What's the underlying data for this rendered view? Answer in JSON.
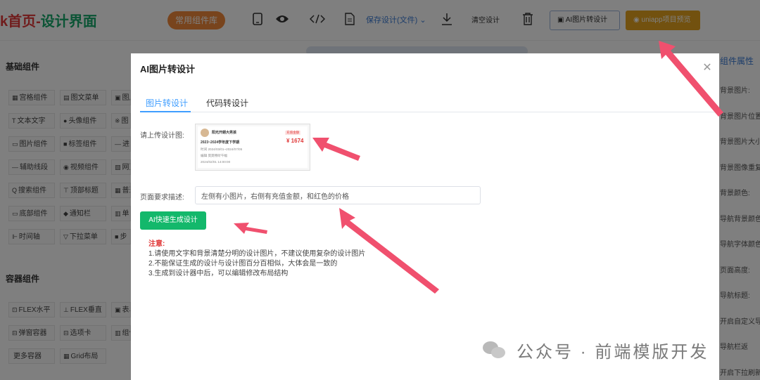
{
  "topbar": {
    "brand_part1": "k首页-",
    "brand_part2": "设计界面",
    "component_lib_label": "常用组件库",
    "save_label": "保存设计(文件)",
    "clear_label": "清空设计",
    "ai_image_label": "AI图片转设计",
    "preview_label": "uniapp项目预览"
  },
  "left": {
    "basic_title": "基础组件",
    "container_title": "容器组件",
    "basic_items": [
      {
        "icon": "▦",
        "label": "宫格组件"
      },
      {
        "icon": "▤",
        "label": "图文菜单"
      },
      {
        "icon": "▣",
        "label": "图片"
      },
      {
        "icon": "T",
        "label": "文本文字"
      },
      {
        "icon": "●",
        "label": "头像组件"
      },
      {
        "icon": "※",
        "label": "图"
      },
      {
        "icon": "▭",
        "label": "图片组件"
      },
      {
        "icon": "■",
        "label": "标签组件"
      },
      {
        "icon": "—",
        "label": "进"
      },
      {
        "icon": "—",
        "label": "辅助线段"
      },
      {
        "icon": "◉",
        "label": "视频组件"
      },
      {
        "icon": "▧",
        "label": "网页"
      },
      {
        "icon": "Q",
        "label": "搜索组件"
      },
      {
        "icon": "⊤",
        "label": "顶部标题"
      },
      {
        "icon": "▦",
        "label": "普通"
      },
      {
        "icon": "▭",
        "label": "底部组件"
      },
      {
        "icon": "◆",
        "label": "通知栏"
      },
      {
        "icon": "▥",
        "label": "单"
      },
      {
        "icon": "⊩",
        "label": "时间轴"
      },
      {
        "icon": "▽",
        "label": "下拉菜单"
      },
      {
        "icon": "■",
        "label": "步"
      }
    ],
    "container_items": [
      {
        "icon": "⊡",
        "label": "FLEX水平"
      },
      {
        "icon": "⊥",
        "label": "FLEX垂直"
      },
      {
        "icon": "▣",
        "label": "表单"
      },
      {
        "icon": "⊟",
        "label": "弹窗容器"
      },
      {
        "icon": "⊟",
        "label": "选项卡"
      },
      {
        "icon": "▥",
        "label": "组件"
      },
      {
        "icon": "",
        "label": "更多容器"
      },
      {
        "icon": "▦",
        "label": "Grid布局"
      }
    ]
  },
  "right": {
    "header": "组件属性",
    "props": [
      "背景图片:",
      "背景图片位置",
      "背景图片大小",
      "背景图像重复",
      "背景颜色:",
      "导航背景颜色",
      "导航字体颜色",
      "页面高度:",
      "导航标题:",
      "开启自定义导",
      "导航栏返",
      "开启下拉刷新"
    ]
  },
  "dialog": {
    "title": "AI图片转设计",
    "tabs": [
      "图片转设计",
      "代码转设计"
    ],
    "upload_label": "请上传设计图:",
    "desc_label": "页面要求描述:",
    "desc_value": "左侧有小图片，右侧有充值金额，和红色的价格",
    "generate_label": "AI快速生成设计",
    "notes_title": "注意:",
    "notes": [
      "1.请使用文字和背景清楚分明的设计图片，不建议使用复杂的设计图片",
      "2.不能保证生成的设计与设计图百分百相似，大体会是一致的",
      "3.生成到设计器中后，可以编辑修改布局结构"
    ],
    "preview_card": {
      "name": "阳光开朗大男孩",
      "term": "2023~2024学年度下学期",
      "time_line": "时间 2024/03/01~2024/07/05",
      "teacher_line": "编辑 莫莫畅听午幅",
      "date_line": "2024/02/01 14:00:00",
      "tag": "充值金额",
      "price": "¥ 1674"
    }
  },
  "watermark": "公众号 · 前端模版开发",
  "colors": {
    "accent_blue": "#409eff",
    "generate_green": "#13b86b",
    "arrow_pink": "#f0506e",
    "preview_gold": "#e5a21e"
  }
}
